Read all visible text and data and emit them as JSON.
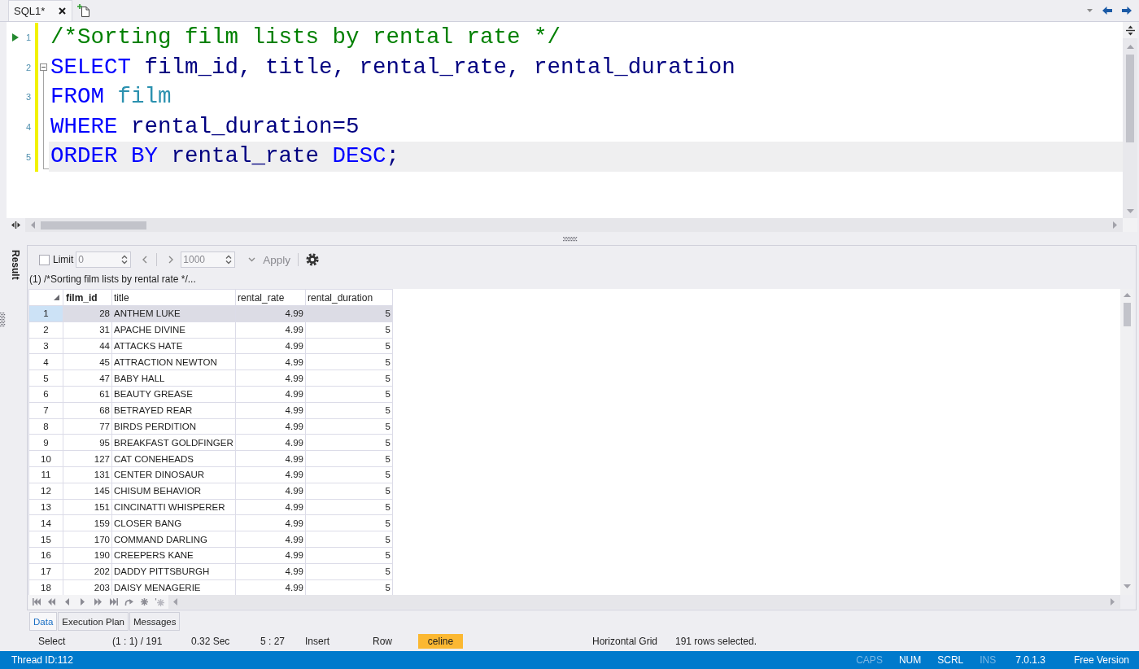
{
  "document_tabs": [
    {
      "label": "SQL1*",
      "selected": true
    }
  ],
  "editor": {
    "lines": [
      {
        "number": "1",
        "run_marker": true,
        "modified": true,
        "fold_start": false,
        "current": false,
        "tokens": [
          {
            "kind": "comment",
            "text": "/*Sorting film lists by rental rate */"
          }
        ]
      },
      {
        "number": "2",
        "run_marker": false,
        "modified": true,
        "fold_start": true,
        "current": false,
        "tokens": [
          {
            "kind": "keyword",
            "text": "SELECT"
          },
          {
            "kind": "identifier",
            "text": " film_id, title, rental_rate, rental_duration"
          }
        ]
      },
      {
        "number": "3",
        "run_marker": false,
        "modified": true,
        "fold_start": false,
        "current": false,
        "tokens": [
          {
            "kind": "keyword",
            "text": "FROM "
          },
          {
            "kind": "object",
            "text": "film"
          }
        ]
      },
      {
        "number": "4",
        "run_marker": false,
        "modified": true,
        "fold_start": false,
        "current": false,
        "tokens": [
          {
            "kind": "keyword",
            "text": "WHERE"
          },
          {
            "kind": "identifier",
            "text": " rental_duration=5"
          }
        ]
      },
      {
        "number": "5",
        "run_marker": false,
        "modified": true,
        "fold_start": false,
        "current": true,
        "tokens": [
          {
            "kind": "keyword",
            "text": "ORDER BY"
          },
          {
            "kind": "identifier",
            "text": " rental_rate "
          },
          {
            "kind": "keyword",
            "text": "DESC"
          },
          {
            "kind": "identifier",
            "text": ";"
          }
        ]
      }
    ]
  },
  "result": {
    "side_tab": "Result",
    "toolbar": {
      "limit": {
        "label": "Limit",
        "checked": false
      },
      "offset_field": {
        "value": "0",
        "disabled": true
      },
      "page_size_field": {
        "value": "1000",
        "disabled": true
      },
      "apply": {
        "label": "Apply",
        "disabled": true
      }
    },
    "caption": "(1) /*Sorting film lists by rental rate */...",
    "grid": {
      "columns": [
        {
          "label": "film_id",
          "kind": "number",
          "primary_key": true
        },
        {
          "label": "title",
          "kind": "text",
          "primary_key": false
        },
        {
          "label": "rental_rate",
          "kind": "number",
          "primary_key": false
        },
        {
          "label": "rental_duration",
          "kind": "number",
          "primary_key": false
        }
      ],
      "rows": [
        {
          "number": "1",
          "selected": true,
          "cells": [
            "28",
            "ANTHEM LUKE",
            "4.99",
            "5"
          ]
        },
        {
          "number": "2",
          "selected": false,
          "cells": [
            "31",
            "APACHE DIVINE",
            "4.99",
            "5"
          ]
        },
        {
          "number": "3",
          "selected": false,
          "cells": [
            "44",
            "ATTACKS HATE",
            "4.99",
            "5"
          ]
        },
        {
          "number": "4",
          "selected": false,
          "cells": [
            "45",
            "ATTRACTION NEWTON",
            "4.99",
            "5"
          ]
        },
        {
          "number": "5",
          "selected": false,
          "cells": [
            "47",
            "BABY HALL",
            "4.99",
            "5"
          ]
        },
        {
          "number": "6",
          "selected": false,
          "cells": [
            "61",
            "BEAUTY GREASE",
            "4.99",
            "5"
          ]
        },
        {
          "number": "7",
          "selected": false,
          "cells": [
            "68",
            "BETRAYED REAR",
            "4.99",
            "5"
          ]
        },
        {
          "number": "8",
          "selected": false,
          "cells": [
            "77",
            "BIRDS PERDITION",
            "4.99",
            "5"
          ]
        },
        {
          "number": "9",
          "selected": false,
          "cells": [
            "95",
            "BREAKFAST GOLDFINGER",
            "4.99",
            "5"
          ]
        },
        {
          "number": "10",
          "selected": false,
          "cells": [
            "127",
            "CAT CONEHEADS",
            "4.99",
            "5"
          ]
        },
        {
          "number": "11",
          "selected": false,
          "cells": [
            "131",
            "CENTER DINOSAUR",
            "4.99",
            "5"
          ]
        },
        {
          "number": "12",
          "selected": false,
          "cells": [
            "145",
            "CHISUM BEHAVIOR",
            "4.99",
            "5"
          ]
        },
        {
          "number": "13",
          "selected": false,
          "cells": [
            "151",
            "CINCINATTI WHISPERER",
            "4.99",
            "5"
          ]
        },
        {
          "number": "14",
          "selected": false,
          "cells": [
            "159",
            "CLOSER BANG",
            "4.99",
            "5"
          ]
        },
        {
          "number": "15",
          "selected": false,
          "cells": [
            "170",
            "COMMAND DARLING",
            "4.99",
            "5"
          ]
        },
        {
          "number": "16",
          "selected": false,
          "cells": [
            "190",
            "CREEPERS KANE",
            "4.99",
            "5"
          ]
        },
        {
          "number": "17",
          "selected": false,
          "cells": [
            "202",
            "DADDY PITTSBURGH",
            "4.99",
            "5"
          ]
        },
        {
          "number": "18",
          "selected": false,
          "cells": [
            "203",
            "DAISY MENAGERIE",
            "4.99",
            "5"
          ]
        }
      ]
    },
    "tabs": [
      {
        "label": "Data",
        "selected": true
      },
      {
        "label": "Execution Plan",
        "selected": false
      },
      {
        "label": "Messages",
        "selected": false
      }
    ]
  },
  "status_row": [
    {
      "kind": "text",
      "text": "Select"
    },
    {
      "kind": "text",
      "text": "(1 : 1) / 191"
    },
    {
      "kind": "text",
      "text": "0.32 Sec"
    },
    {
      "kind": "text",
      "text": "5 : 27"
    },
    {
      "kind": "text",
      "text": "Insert"
    },
    {
      "kind": "text",
      "text": "Row"
    },
    {
      "kind": "connection",
      "text": "celine"
    },
    {
      "kind": "text",
      "text": "Horizontal Grid"
    },
    {
      "kind": "text",
      "text": "191 rows selected."
    }
  ],
  "status_bar": {
    "thread": "Thread ID:112",
    "indicators": [
      {
        "label": "CAPS",
        "on": false
      },
      {
        "label": "NUM",
        "on": true
      },
      {
        "label": "SCRL",
        "on": true
      },
      {
        "label": "INS",
        "on": false
      }
    ],
    "version": "7.0.1.3",
    "edition": "Free Version"
  }
}
